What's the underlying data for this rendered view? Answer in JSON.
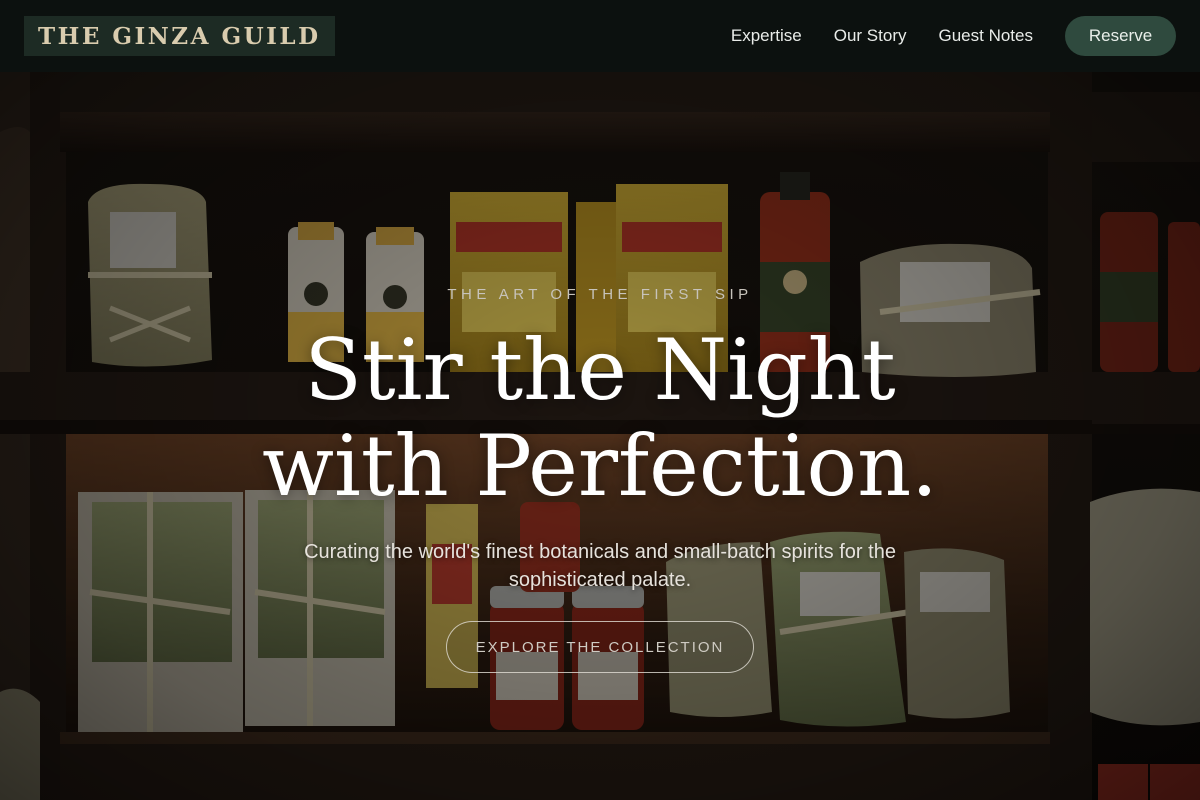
{
  "brand": {
    "name": "THE GINZA GUILD"
  },
  "nav": {
    "links": [
      "Expertise",
      "Our Story",
      "Guest Notes"
    ],
    "reserve_label": "Reserve"
  },
  "hero": {
    "eyebrow": "THE ART OF THE FIRST SIP",
    "headline_line1": "Stir the Night",
    "headline_line2": "with Perfection.",
    "subtitle": "Curating the world's finest botanicals and small-batch spirits for the sophisticated palate.",
    "cta_label": "EXPLORE THE COLLECTION"
  },
  "colors": {
    "nav_bg": "#0c110f",
    "logo_bg": "#1d2b24",
    "logo_text": "#d9ccae",
    "reserve_bg": "#2f4a3e",
    "hero_text": "#ffffff"
  }
}
